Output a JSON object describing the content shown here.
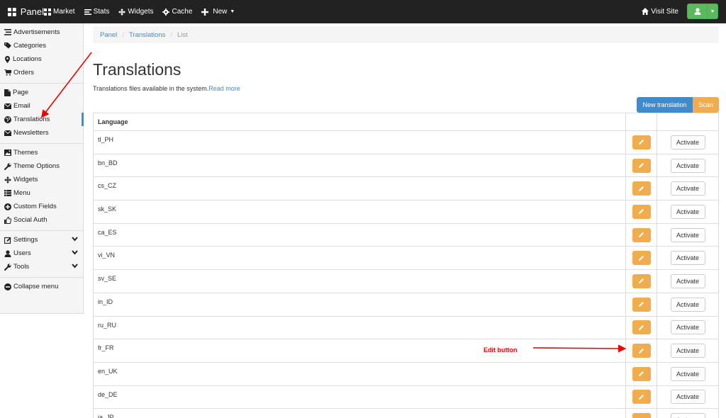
{
  "navbar": {
    "brand": "Panel",
    "items": [
      "Market",
      "Stats",
      "Widgets",
      "Cache",
      "New"
    ],
    "visit_site": "Visit Site"
  },
  "sidebar": {
    "groups": [
      [
        "Advertisements",
        "Categories",
        "Locations",
        "Orders"
      ],
      [
        "Page",
        "Email",
        "Translations",
        "Newsletters"
      ],
      [
        "Themes",
        "Theme Options",
        "Widgets",
        "Menu",
        "Custom Fields",
        "Social Auth"
      ],
      [
        "Settings",
        "Users",
        "Tools"
      ],
      [
        "Collapse menu"
      ]
    ],
    "active": "Translations"
  },
  "breadcrumb": {
    "home": "Panel",
    "section": "Translations",
    "current": "List"
  },
  "page": {
    "title": "Translations",
    "description": "Translations files available in the system.",
    "read_more": "Read more"
  },
  "actions": {
    "new_translation": "New translation",
    "scan": "Scan"
  },
  "table": {
    "header": "Language",
    "activate_label": "Activate",
    "rows": [
      "tl_PH",
      "bn_BD",
      "cs_CZ",
      "sk_SK",
      "ca_ES",
      "vi_VN",
      "sv_SE",
      "in_ID",
      "ru_RU",
      "fr_FR",
      "en_UK",
      "de_DE",
      "ja_JP"
    ]
  },
  "annotation": {
    "label": "Edit button"
  },
  "colors": {
    "navbar": "#222222",
    "primary": "#428bca",
    "warning": "#f0ad4e",
    "success": "#5cb85c",
    "annotation": "#e00000"
  }
}
